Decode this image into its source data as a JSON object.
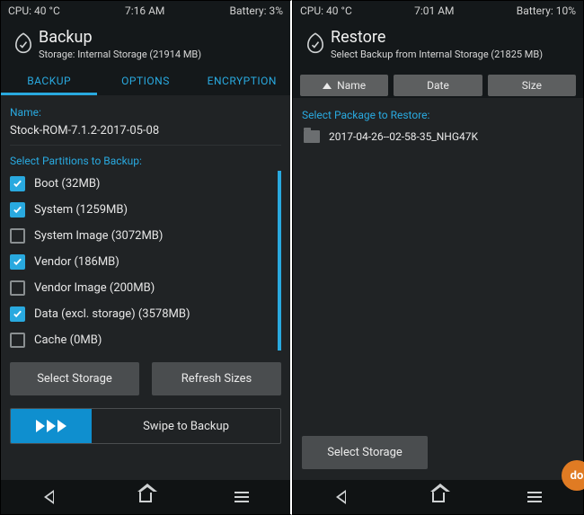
{
  "left": {
    "status": {
      "cpu": "CPU: 40 °C",
      "time": "7:16 AM",
      "battery": "Battery: 3%"
    },
    "header": {
      "title": "Backup",
      "sub": "Storage: Internal Storage (21914 MB)"
    },
    "tabs": {
      "backup": "BACKUP",
      "options": "OPTIONS",
      "encryption": "ENCRYPTION"
    },
    "name_label": "Name:",
    "name_value": "Stock-ROM-7.1.2-2017-05-08",
    "partitions_label": "Select Partitions to Backup:",
    "partitions": [
      {
        "label": "Boot (32MB)",
        "checked": true
      },
      {
        "label": "System (1259MB)",
        "checked": true
      },
      {
        "label": "System Image (3072MB)",
        "checked": false
      },
      {
        "label": "Vendor (186MB)",
        "checked": true
      },
      {
        "label": "Vendor Image (200MB)",
        "checked": false
      },
      {
        "label": "Data (excl. storage) (3578MB)",
        "checked": true
      },
      {
        "label": "Cache (0MB)",
        "checked": false
      }
    ],
    "buttons": {
      "select_storage": "Select Storage",
      "refresh_sizes": "Refresh Sizes"
    },
    "swipe_label": "Swipe to Backup"
  },
  "right": {
    "status": {
      "cpu": "CPU: 40 °C",
      "time": "7:01 AM",
      "battery": "Battery: 10%"
    },
    "header": {
      "title": "Restore",
      "sub": "Select Backup from Internal Storage (21825 MB)"
    },
    "sort": {
      "name": "Name",
      "date": "Date",
      "size": "Size"
    },
    "select_label": "Select Package to Restore:",
    "packages": [
      "2017-04-26--02-58-35_NHG47K"
    ],
    "buttons": {
      "select_storage": "Select Storage"
    }
  }
}
